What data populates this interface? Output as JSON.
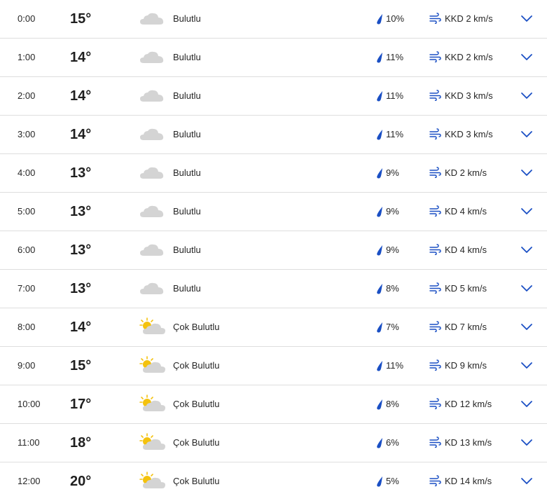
{
  "hours": [
    {
      "time": "0:00",
      "temp": "15°",
      "icon": "cloud-icon",
      "condition": "Bulutlu",
      "precip": "10%",
      "wind": "KKD 2 km/s"
    },
    {
      "time": "1:00",
      "temp": "14°",
      "icon": "cloud-icon",
      "condition": "Bulutlu",
      "precip": "11%",
      "wind": "KKD 2 km/s"
    },
    {
      "time": "2:00",
      "temp": "14°",
      "icon": "cloud-icon",
      "condition": "Bulutlu",
      "precip": "11%",
      "wind": "KKD 3 km/s"
    },
    {
      "time": "3:00",
      "temp": "14°",
      "icon": "cloud-icon",
      "condition": "Bulutlu",
      "precip": "11%",
      "wind": "KKD 3 km/s"
    },
    {
      "time": "4:00",
      "temp": "13°",
      "icon": "cloud-icon",
      "condition": "Bulutlu",
      "precip": "9%",
      "wind": "KD 2 km/s"
    },
    {
      "time": "5:00",
      "temp": "13°",
      "icon": "cloud-icon",
      "condition": "Bulutlu",
      "precip": "9%",
      "wind": "KD 4 km/s"
    },
    {
      "time": "6:00",
      "temp": "13°",
      "icon": "cloud-icon",
      "condition": "Bulutlu",
      "precip": "9%",
      "wind": "KD 4 km/s"
    },
    {
      "time": "7:00",
      "temp": "13°",
      "icon": "cloud-icon",
      "condition": "Bulutlu",
      "precip": "8%",
      "wind": "KD 5 km/s"
    },
    {
      "time": "8:00",
      "temp": "14°",
      "icon": "sun-behind-cloud-icon",
      "condition": "Çok Bulutlu",
      "precip": "7%",
      "wind": "KD 7 km/s"
    },
    {
      "time": "9:00",
      "temp": "15°",
      "icon": "sun-behind-cloud-icon",
      "condition": "Çok Bulutlu",
      "precip": "11%",
      "wind": "KD 9 km/s"
    },
    {
      "time": "10:00",
      "temp": "17°",
      "icon": "sun-behind-cloud-icon",
      "condition": "Çok Bulutlu",
      "precip": "8%",
      "wind": "KD 12 km/s"
    },
    {
      "time": "11:00",
      "temp": "18°",
      "icon": "sun-behind-cloud-icon",
      "condition": "Çok Bulutlu",
      "precip": "6%",
      "wind": "KD 13 km/s"
    },
    {
      "time": "12:00",
      "temp": "20°",
      "icon": "sun-behind-cloud-icon",
      "condition": "Çok Bulutlu",
      "precip": "5%",
      "wind": "KD 14 km/s"
    }
  ],
  "colors": {
    "accent": "#1a4fc4",
    "cloud": "#d4d4d4",
    "sun": "#f4c20d",
    "divider": "#dedede"
  },
  "icons": {
    "precip": "raindrop-icon",
    "wind": "wind-icon",
    "expand": "chevron-down-icon"
  }
}
